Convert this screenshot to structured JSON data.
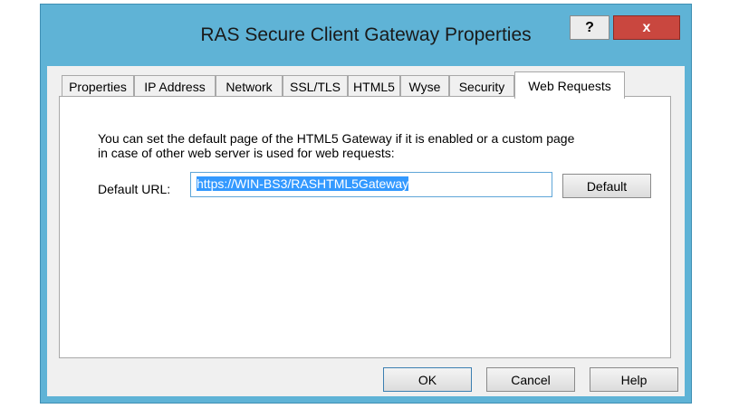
{
  "window": {
    "title": "RAS Secure Client Gateway Properties",
    "help_glyph": "?",
    "close_glyph": "x"
  },
  "tabs": [
    {
      "label": "Properties"
    },
    {
      "label": "IP Address"
    },
    {
      "label": "Network"
    },
    {
      "label": "SSL/TLS"
    },
    {
      "label": "HTML5"
    },
    {
      "label": "Wyse"
    },
    {
      "label": "Security"
    },
    {
      "label": "Web Requests",
      "active": true
    }
  ],
  "web_requests": {
    "description_line1": "You can set the default page of the HTML5 Gateway if it is enabled or a custom page",
    "description_line2": "in case of other web server is used for web requests:",
    "url_label": "Default URL:",
    "url_value": "https://WIN-BS3/RASHTML5Gateway",
    "default_button": "Default"
  },
  "footer": {
    "ok": "OK",
    "cancel": "Cancel",
    "help": "Help"
  }
}
